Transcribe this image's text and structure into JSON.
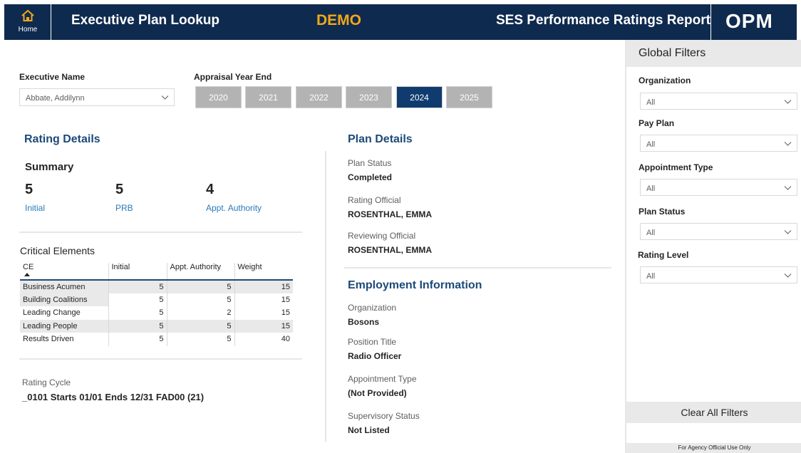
{
  "header": {
    "home_label": "Home",
    "title": "Executive Plan Lookup",
    "demo": "DEMO",
    "report_title": "SES Performance Ratings Report",
    "logo": "OPM",
    "home_icon": "home-icon"
  },
  "selectors": {
    "executive_label": "Executive Name",
    "executive_value": "Abbate, Addilynn",
    "year_label": "Appraisal Year End",
    "years": [
      "2020",
      "2021",
      "2022",
      "2023",
      "2024",
      "2025"
    ],
    "selected_year": "2024"
  },
  "rating": {
    "title": "Rating Details",
    "summary_title": "Summary",
    "summary": [
      {
        "value": "5",
        "label": "Initial"
      },
      {
        "value": "5",
        "label": "PRB"
      },
      {
        "value": "4",
        "label": "Appt. Authority"
      }
    ],
    "ce_title": "Critical Elements",
    "ce_headers": [
      "CE",
      "Initial",
      "Appt. Authority",
      "Weight"
    ],
    "ce_rows": [
      {
        "ce": "Business Acumen",
        "initial": "5",
        "appt": "5",
        "weight": "15"
      },
      {
        "ce": "Building Coalitions",
        "initial": "5",
        "appt": "5",
        "weight": "15"
      },
      {
        "ce": "Leading Change",
        "initial": "5",
        "appt": "2",
        "weight": "15"
      },
      {
        "ce": "Leading People",
        "initial": "5",
        "appt": "5",
        "weight": "15"
      },
      {
        "ce": "Results Driven",
        "initial": "5",
        "appt": "5",
        "weight": "40"
      }
    ],
    "cycle_label": "Rating Cycle",
    "cycle_value": "_0101 Starts 01/01 Ends 12/31 FAD00 (21)"
  },
  "plan": {
    "title": "Plan Details",
    "fields": [
      {
        "label": "Plan Status",
        "value": "Completed"
      },
      {
        "label": "Rating Official",
        "value": "ROSENTHAL, EMMA"
      },
      {
        "label": "Reviewing Official",
        "value": "ROSENTHAL, EMMA"
      }
    ]
  },
  "employment": {
    "title": "Employment Information",
    "fields": [
      {
        "label": "Organization",
        "value": "Bosons"
      },
      {
        "label": "Position Title",
        "value": "Radio Officer"
      },
      {
        "label": "Appointment Type",
        "value": "(Not Provided)"
      },
      {
        "label": "Supervisory Status",
        "value": "Not Listed"
      }
    ]
  },
  "filters": {
    "title": "Global Filters",
    "items": [
      {
        "label": "Organization",
        "value": "All"
      },
      {
        "label": "Pay Plan",
        "value": "All"
      },
      {
        "label": "Appointment Type",
        "value": "All"
      },
      {
        "label": "Plan Status",
        "value": "All"
      },
      {
        "label": "Rating Level",
        "value": "All"
      }
    ],
    "clear_label": "Clear All Filters",
    "footer": "For Agency Official Use Only"
  },
  "colors": {
    "header_bg": "#0f2a4f",
    "demo": "#f0a81a",
    "section_title": "#1c4a7a",
    "selected_year": "#0f3b6e",
    "link": "#2a7ab8"
  }
}
